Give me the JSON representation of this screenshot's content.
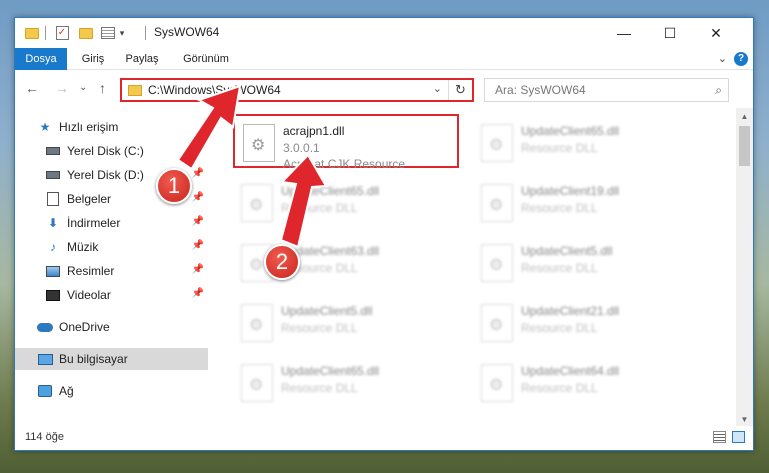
{
  "titlebar": {
    "title": "SysWOW64",
    "qa_dropdown": "▾",
    "minimize": "—",
    "maximize": "☐",
    "close": "✕"
  },
  "ribbon": {
    "tabs": [
      {
        "label": "Dosya",
        "active": true
      },
      {
        "label": "Giriş"
      },
      {
        "label": "Paylaş"
      },
      {
        "label": "Görünüm"
      }
    ],
    "expand": "⌄",
    "help": "?"
  },
  "nav": {
    "back": "←",
    "forward": "→",
    "recent": "⌄",
    "up": "↑",
    "path": "C:\\Windows\\SysWOW64",
    "path_dropdown": "⌄",
    "refresh": "↻",
    "search_placeholder": "Ara: SysWOW64",
    "search_icon": "⌕"
  },
  "sidebar": {
    "items": [
      {
        "label": "Hızlı erişim",
        "icon": "star-icon"
      },
      {
        "label": "Yerel Disk (C:)",
        "icon": "disk-icon",
        "pinned": true
      },
      {
        "label": "Yerel Disk (D:)",
        "icon": "disk-icon",
        "pinned": true
      },
      {
        "label": "Belgeler",
        "icon": "document-icon",
        "pinned": true
      },
      {
        "label": "İndirmeler",
        "icon": "download-icon",
        "pinned": true
      },
      {
        "label": "Müzik",
        "icon": "music-icon",
        "pinned": true
      },
      {
        "label": "Resimler",
        "icon": "pictures-icon",
        "pinned": true
      },
      {
        "label": "Videolar",
        "icon": "videos-icon",
        "pinned": true
      },
      {
        "label": "OneDrive",
        "icon": "onedrive-icon"
      },
      {
        "label": "Bu bilgisayar",
        "icon": "this-pc-icon",
        "selected": true
      },
      {
        "label": "Ağ",
        "icon": "network-icon"
      }
    ],
    "pin_glyph": "📌"
  },
  "files": [
    {
      "name": "acrajpn1.dll",
      "version": "3.0.0.1",
      "desc": "Acrobat CJK Resource",
      "highlighted": true
    },
    {
      "name": "UpdateClient65.dll",
      "desc": "Resource DLL"
    },
    {
      "name": "UpdateClient65.dll",
      "desc": "Resource DLL"
    },
    {
      "name": "UpdateClient19.dll",
      "desc": "Resource DLL"
    },
    {
      "name": "UpdateClient63.dll",
      "desc": "Resource DLL"
    },
    {
      "name": "UpdateClient5.dll",
      "desc": "Resource DLL"
    },
    {
      "name": "UpdateClient5.dll",
      "desc": "Resource DLL"
    },
    {
      "name": "UpdateClient21.dll",
      "desc": "Resource DLL"
    },
    {
      "name": "UpdateClient65.dll",
      "desc": "Resource DLL"
    },
    {
      "name": "UpdateClient64.dll",
      "desc": "Resource DLL"
    }
  ],
  "status": {
    "count": "114 öğe"
  },
  "callouts": [
    {
      "number": "1"
    },
    {
      "number": "2"
    }
  ],
  "colors": {
    "accent": "#1979ca",
    "highlight": "#e0262d"
  }
}
